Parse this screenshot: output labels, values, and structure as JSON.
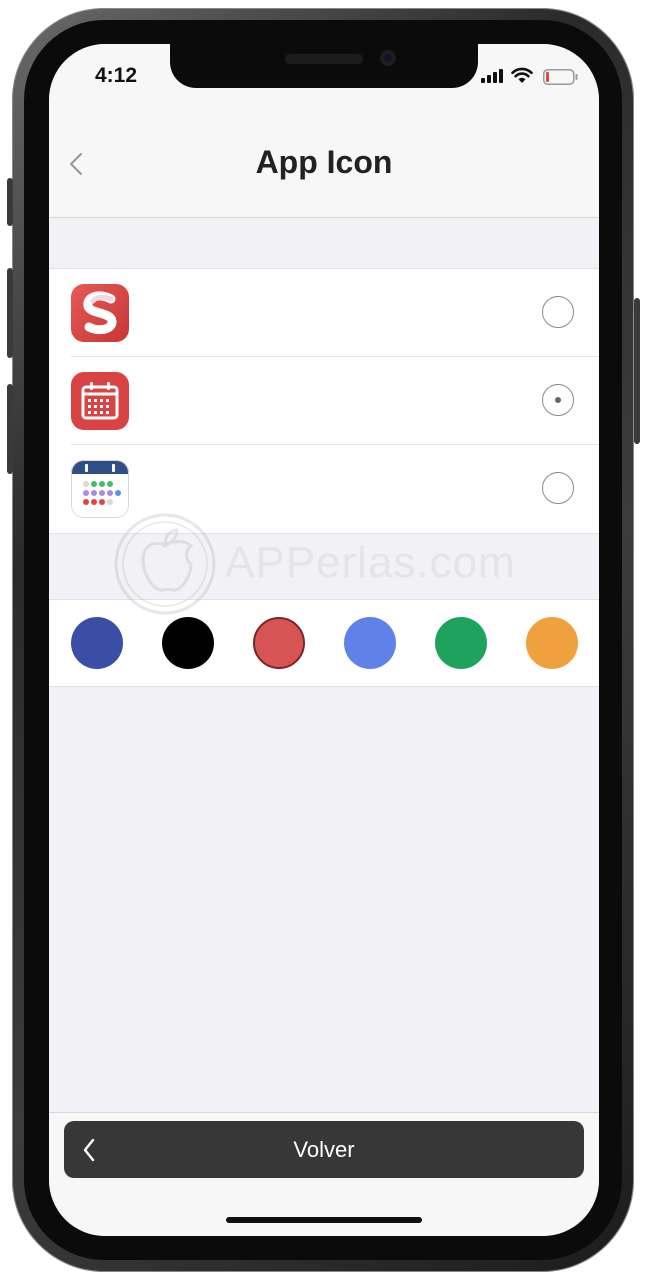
{
  "status_bar": {
    "time": "4:12",
    "icons": [
      "signal-icon",
      "wifi-icon",
      "battery-icon"
    ],
    "battery_color": "#e24a3b"
  },
  "nav": {
    "title": "App Icon",
    "back_icon": "chevron-left-icon"
  },
  "icon_options": [
    {
      "name": "red-s-app-icon",
      "selected": false
    },
    {
      "name": "red-calendar-app-icon",
      "selected": true
    },
    {
      "name": "white-calendar-app-icon",
      "selected": false
    }
  ],
  "colors": {
    "swatches": [
      "#3a4ea6",
      "#000000",
      "#d75455",
      "#6081e8",
      "#1ea25e",
      "#f0a03f"
    ]
  },
  "watermark": {
    "text": "APPerlas.com"
  },
  "bottom": {
    "back_label": "Volver",
    "chevron_icon": "chevron-left-icon"
  },
  "accent": {
    "button_dark": "#373737",
    "icon_red": "#d94343"
  }
}
